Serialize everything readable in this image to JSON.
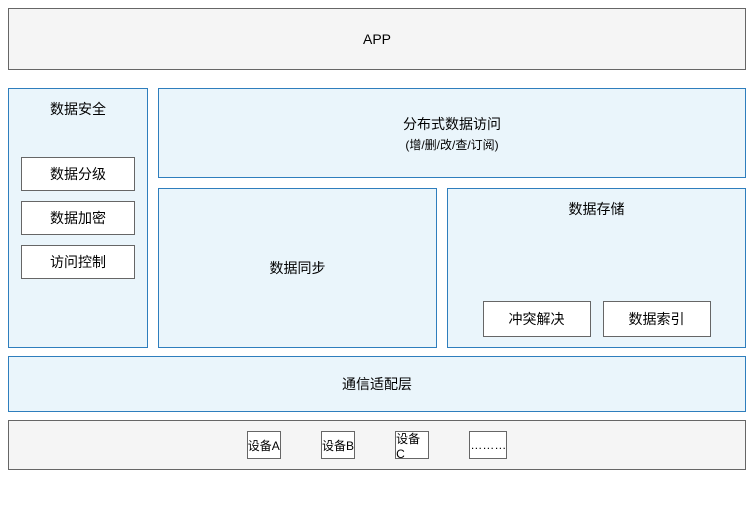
{
  "app_title": "APP",
  "security": {
    "title": "数据安全",
    "items": [
      "数据分级",
      "数据加密",
      "访问控制"
    ]
  },
  "distributed_access": {
    "title": "分布式数据访问",
    "subtitle": "(增/删/改/查/订阅)"
  },
  "data_sync": "数据同步",
  "data_storage": {
    "title": "数据存储",
    "items": [
      "冲突解决",
      "数据索引"
    ]
  },
  "comm_layer": "通信适配层",
  "devices": [
    "设备A",
    "设备B",
    "设备C",
    "………"
  ]
}
